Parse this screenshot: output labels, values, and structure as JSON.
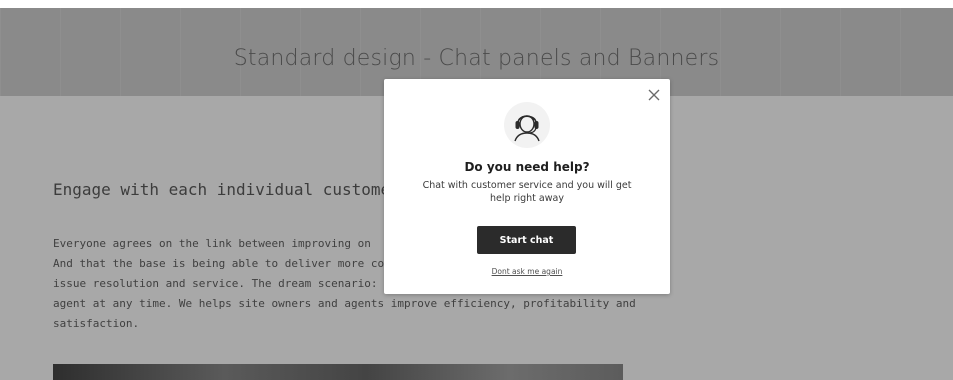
{
  "header": {
    "title": "Standard design - Chat panels and Banners"
  },
  "article": {
    "heading": "Engage with each individual customer",
    "lines": [
      "Everyone agrees on the link between improving on",
      "And that the base is being able to deliver more co",
      "issue resolution and service. The dream scenario:",
      "agent at any time. We helps site owners and agents improve efficiency, profitability and",
      "satisfaction."
    ]
  },
  "modal": {
    "icon": "support-agent-icon",
    "title": "Do you need help?",
    "description": "Chat with customer service and you will get help right away",
    "start_chat_label": "Start chat",
    "dont_ask_label": "Dont ask me again",
    "close_icon": "close-icon"
  },
  "colors": {
    "overlay": "#8a8a8a",
    "button_bg": "#2b2b2b",
    "modal_bg": "#ffffff"
  }
}
